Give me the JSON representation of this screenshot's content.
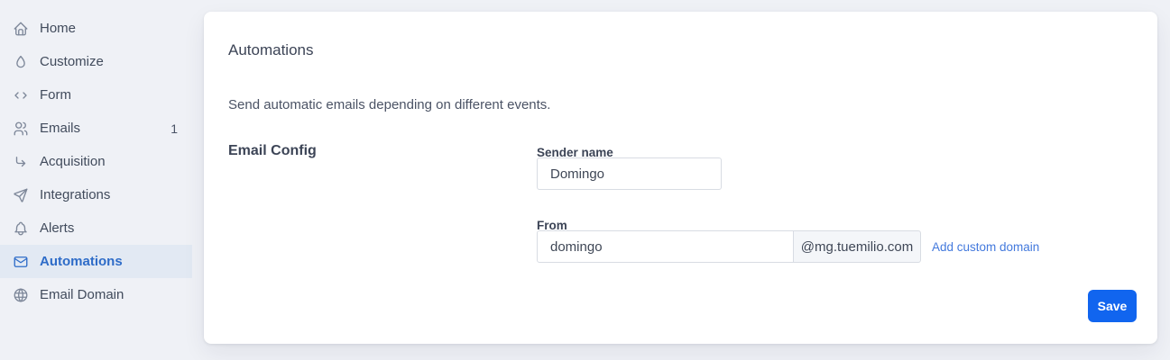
{
  "sidebar": {
    "items": [
      {
        "label": "Home",
        "icon": "home-icon"
      },
      {
        "label": "Customize",
        "icon": "droplet-icon"
      },
      {
        "label": "Form",
        "icon": "code-icon"
      },
      {
        "label": "Emails",
        "icon": "users-icon",
        "badge": "1"
      },
      {
        "label": "Acquisition",
        "icon": "corner-down-right-icon"
      },
      {
        "label": "Integrations",
        "icon": "send-icon"
      },
      {
        "label": "Alerts",
        "icon": "bell-icon"
      },
      {
        "label": "Automations",
        "icon": "mail-icon",
        "active": true
      },
      {
        "label": "Email Domain",
        "icon": "globe-icon"
      }
    ]
  },
  "main": {
    "title": "Automations",
    "description": "Send automatic emails depending on different events.",
    "section_title": "Email Config",
    "sender_name": {
      "label": "Sender name",
      "value": "Domingo"
    },
    "from": {
      "label": "From",
      "value": "domingo",
      "domain_suffix": "@mg.tuemilio.com"
    },
    "add_custom_domain_label": "Add custom domain",
    "save_label": "Save"
  },
  "colors": {
    "accent_blue": "#1165ef",
    "link_blue": "#4379dd",
    "active_item_text": "#2e6cc8",
    "active_item_bg": "#e2e9f3",
    "page_background": "#eff1f6"
  }
}
